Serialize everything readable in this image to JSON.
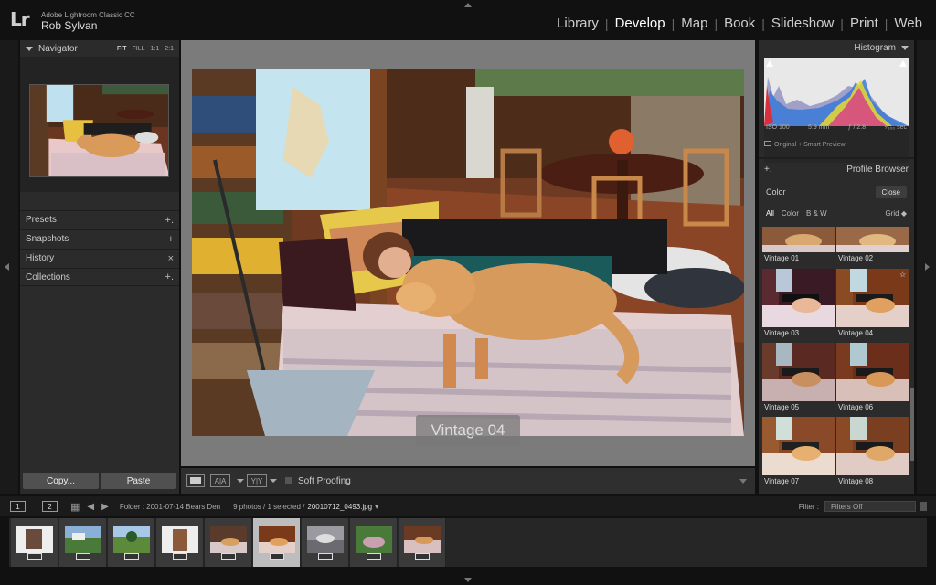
{
  "app": {
    "logo": "Lr",
    "title": "Adobe Lightroom Classic CC",
    "user": "Rob Sylvan"
  },
  "modules": [
    {
      "label": "Library",
      "active": false
    },
    {
      "label": "Develop",
      "active": true
    },
    {
      "label": "Map",
      "active": false
    },
    {
      "label": "Book",
      "active": false
    },
    {
      "label": "Slideshow",
      "active": false
    },
    {
      "label": "Print",
      "active": false
    },
    {
      "label": "Web",
      "active": false
    }
  ],
  "left_panel": {
    "navigator": {
      "title": "Navigator",
      "zoom": [
        "FIT",
        "FILL",
        "1:1",
        "2:1"
      ]
    },
    "sections": [
      {
        "label": "Presets",
        "action": "+."
      },
      {
        "label": "Snapshots",
        "action": "+"
      },
      {
        "label": "History",
        "action": "×"
      },
      {
        "label": "Collections",
        "action": "+."
      }
    ],
    "copy": "Copy...",
    "paste": "Paste"
  },
  "center": {
    "overlay_label": "Vintage 04"
  },
  "toolbar": {
    "soft_proofing": "Soft Proofing",
    "compare_ab": "A|A",
    "compare_yy": "Y|Y"
  },
  "right_panel": {
    "histogram": {
      "title": "Histogram",
      "iso": "ISO 100",
      "focal": "5.9 mm",
      "aperture": "ƒ / 2.8",
      "shutter": "¹⁄₁₀₀ sec",
      "preview": "Original + Smart Preview"
    },
    "profile_browser": {
      "title": "Profile Browser",
      "plus": "+.",
      "group": "Color",
      "close": "Close",
      "filters": [
        "All",
        "Color",
        "B & W"
      ],
      "view": "Grid",
      "profiles": [
        "Vintage 01",
        "Vintage 02",
        "Vintage 03",
        "Vintage 04",
        "Vintage 05",
        "Vintage 06",
        "Vintage 07",
        "Vintage 08"
      ]
    }
  },
  "filmstrip": {
    "pages": [
      "1",
      "2"
    ],
    "folder": "Folder : 2001-07-14 Bears Den",
    "count": "9 photos / 1 selected /",
    "selected_file": "20010712_0493.jpg",
    "filter_label": "Filter :",
    "filter_value": "Filters Off",
    "thumbs": 9,
    "selected_index": 5
  },
  "colors": {
    "accent": "#ffffff",
    "panel": "#2b2b2b",
    "bg": "#111111",
    "center": "#7b7b7b"
  },
  "icons": [
    "grid-icon",
    "back-arrow-icon",
    "forward-arrow-icon",
    "histogram-clipping-icon"
  ]
}
